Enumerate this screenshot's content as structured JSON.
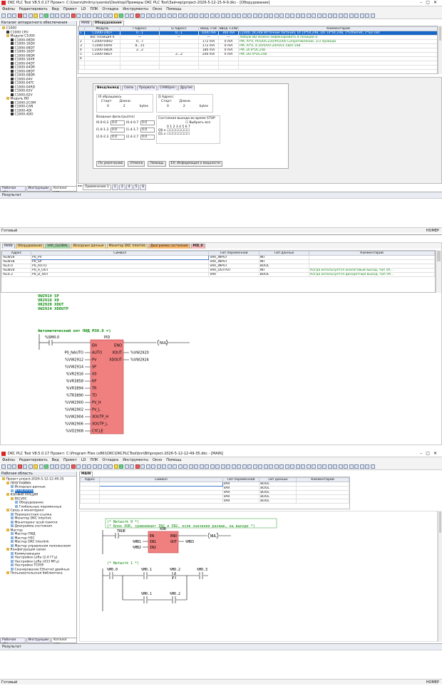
{
  "w1": {
    "title": "DKC PLC Tool V8.5.0.17   Проект: C:\\Users\\dmitriy.lysenko\\Desktop\\Примеры DKC PLC Tool\\Зайчер\\project-2026-5-12-15-9-9.dkc - [Оборудование]",
    "menu": [
      "Файлы",
      "Редактировать",
      "Вид",
      "Проект",
      "LD",
      "ПЛК",
      "Отладка",
      "Инструменты",
      "Окно",
      "Помощь"
    ],
    "tree_header": "Каталог аппаратного обеспечения",
    "tree": [
      "C1000",
      "C1000 CPU",
      "Модули C1000",
      "C1000-08DX",
      "C1000-16DX",
      "C1000-08DT",
      "C1000-16DT",
      "C1000-08DR",
      "C1000-16XR",
      "C1000-04DT",
      "C1000-04DR",
      "C1000-08DT",
      "C1000-08DR",
      "C1000-04V",
      "C1000-04TC",
      "C1000-04RD",
      "C1000-02V",
      "C1000-02V",
      "Модуль BD",
      "C1000-2COM",
      "C1000-CAN",
      "C1000-4DI",
      "C1000-4DO"
    ],
    "doc_tabs": [
      "MAIN",
      "Оборудование"
    ],
    "hw_cols": [
      "",
      "Модуль",
      "I Адресс",
      "Q Адресс",
      "Ввод +5В",
      "Ввод +24В",
      "Комментарий"
    ],
    "hw_rows": [
      [
        "1",
        "C1000-24DT",
        "0...1",
        "0...1",
        "1000 mA",
        "360 mA",
        "C1000, DC24B Источник питания, DI 14*DC24B, DO 10*DC24B, 1*Ethernet, 1*SD slot"
      ],
      [
        "",
        "BD: Позиция 0",
        "—",
        "—",
        "—",
        "—",
        "Любую BD можно зафиксировать в позиции 0."
      ],
      [
        "2",
        "C1000-04RD",
        "0...7",
        "",
        "172 mA",
        "0 mA",
        "PM, AI*4, Pt100/Cu50/Pt1000 Сопротивление, 2/3 провода"
      ],
      [
        "3",
        "C1000-04AV",
        "8...15",
        "",
        "172 mA",
        "0 mA",
        "PM, AI*4, 4-20mA/0-20mA/1-5B/0-10B"
      ],
      [
        "4",
        "C1000-08DX",
        "2...2",
        "",
        "180 mA",
        "0 mA",
        "PM, DI 8*DC24B"
      ],
      [
        "5",
        "C1000-08DT",
        "",
        "2...2",
        "200 mA",
        "0 mA",
        "PM, DO 8*DC24B"
      ],
      [
        "6",
        "",
        "",
        "",
        "",
        "",
        ""
      ]
    ],
    "cfg_tabs": [
      "Ввод/вывод",
      "Связь",
      "Прервать",
      "CANOpen",
      "Другие"
    ],
    "i_group": "I0 обращаюсь",
    "q_group": "Q Адресс",
    "start_label": "Старт:",
    "len_label": "Длина:",
    "i_start": "0",
    "i_len": "2",
    "q_start": "0",
    "q_len": "2",
    "bytes": "bytes",
    "filter_label": "Входные фильтры(ms)",
    "filters": [
      [
        "I0.0-0.3",
        "0.0",
        "I0.4-0.7",
        "0.0"
      ],
      [
        "I1.0-1.3",
        "0.0",
        "I1.4-1.7",
        "0.0"
      ],
      [
        "I2.0-2.3",
        "0.0",
        "I2.4-2.7",
        "0.0"
      ]
    ],
    "stop_label": "Состояния выхода во время STOP",
    "select_all": "Выбрать все",
    "bits": "0 1 2 3 4 5 6 7",
    "q0": "Q0.x",
    "q1": "Q1.x",
    "buttons": [
      "По умолчанию",
      "Отмена",
      "Помощь",
      "ЕХ: Информация о мощности"
    ],
    "bottom_tabs": [
      "Рабочая обл...",
      "Инструкции",
      "Каталог апп..."
    ],
    "page_tabs": [
      "Применение 1",
      "2",
      "3",
      "4",
      "5",
      "6"
    ],
    "result": "Результат",
    "status_left": "Готовый",
    "status_right": "НОМЕР"
  },
  "w2": {
    "tabs": [
      "MAIN",
      "Оборудование",
      "VAR_GLOBAL",
      "Исходные данные",
      "Монитор DKC Interlink",
      "Диаграмма состояния",
      "PID_0"
    ],
    "cols": [
      "Адрес",
      "Символ",
      "Тип переменной",
      "Тип данных",
      "Комментарий"
    ],
    "rows": [
      [
        "%LW16",
        "P0_PV",
        "VAR_INPUT",
        "INT",
        ""
      ],
      [
        "%LW18",
        "P0_SP",
        "VAR_INPUT",
        "INT",
        ""
      ],
      [
        "%L0.0",
        "P0_AUTO",
        "VAR_INPUT",
        "BOOL",
        ""
      ],
      [
        "%LW20",
        "P0_A_OUT",
        "VAR_OUTPUT",
        "INT",
        "Когда используется аналоговый выход, тип VA..."
      ],
      [
        "%L0.2",
        "P0_D_OUT",
        "VAR",
        "BOOL",
        "Когда используется дискретный выход, тип VA..."
      ]
    ],
    "code": [
      "VW2914 SP",
      "VR2916 X0",
      "VR2920 XOUT",
      "VW2924 XDOUTP"
    ],
    "comment": "Автоматический опт ПИД  M30.0 =)",
    "contact": "%SM0.0",
    "block_name": "PID",
    "pins_in": [
      "EN",
      "AUTO",
      "PV",
      "SP",
      "X0",
      "KP",
      "TR",
      "TD",
      "PV_H",
      "PV_L",
      "XOUTP_H",
      "XOUTP_L",
      "CYCLE"
    ],
    "pins_out": [
      "ENO",
      "XOUT",
      "XDOUT"
    ],
    "inputs": [
      "",
      "P0_NAUTO",
      "%VW2912",
      "%VW2914",
      "%VR2916",
      "%VR3858",
      "%VR3894",
      "%TR3890",
      "%VW2900",
      "%VW2902",
      "%VW2904",
      "%VW2906",
      "%VD2908"
    ],
    "outputs": [
      "",
      "%VW2920",
      "%VW2924"
    ],
    "coil": "NUL"
  },
  "w3": {
    "title": "DKC PLC Tool V8.5.0.17   Проект: C:\\Program Files (x86)\\DKC\\DKCPLCTool\\bin\\Bit\\project-2026-5-12-12-49-35.dkc - [MAIN]",
    "menu": [
      "Файлы",
      "Редактировать",
      "Вид",
      "Проект",
      "LD",
      "ПЛК",
      "Отладка",
      "Инструменты",
      "Окно",
      "Помощь"
    ],
    "tree_header": "Рабочая область",
    "tree": [
      "Проект project-2026-5-12-12-49-35",
      "ПРОГРАММА",
      "Исходные данные",
      "MAIN(MAIN)",
      "КОНФИГУРАЦИЯ",
      "РЕСУРС",
      "Оборудование",
      "Глобальные переменные",
      "Связь и мониторинг",
      "Перекрестная ссылка",
      "Монитор DKC Interlink",
      "Мониторинг всей памяти",
      "Диаграмма состояния",
      "Мастер",
      "Мастер ПИД",
      "Мастер HSC",
      "Мастер DKC Interlink",
      "Мастер управления положением",
      "Конфигурация связи",
      "Коммуникация",
      "Настройки LoRa (2,4 ГГц)",
      "Настройки LoRa (433 МГц)",
      "Настройки TCP/IP",
      "Сканирование Ethernet двойных",
      "Пользовательская библиотека"
    ],
    "doc_tab": "MAIN",
    "cols": [
      "Адрес",
      "Символ",
      "Тип переменной",
      "Тип данных",
      "Комментарий"
    ],
    "rows": [
      [
        "",
        "",
        "VAR",
        "BOOL",
        ""
      ],
      [
        "",
        "",
        "VAR",
        "BOOL",
        ""
      ],
      [
        "",
        "",
        "VAR",
        "BOOL",
        ""
      ],
      [
        "",
        "",
        "VAR",
        "BOOL",
        ""
      ],
      [
        "",
        "",
        "VAR",
        "BOOL",
        ""
      ]
    ],
    "net0": "(* Network 0 *)",
    "net0_desc": "(* Блок XOR, сравнивает IN1 и IN2, если значения разные, на выходе *)",
    "true_lbl": "TRUE",
    "xor_name": "XOR",
    "xor_in": [
      "EN",
      "IN1",
      "IN2"
    ],
    "xor_out": [
      "ENO",
      "OUT"
    ],
    "xor_vars": [
      "%MB1",
      "%MB2"
    ],
    "xor_outvar": "%MB3",
    "coil": "NUL",
    "net1": "(* Network 1 *)",
    "contacts": [
      "%M0.0",
      "%M0.1",
      "%M0.2",
      "%M0.3"
    ],
    "branch": [
      "%M0.1",
      "%M0.2"
    ],
    "bottom_tabs": [
      "Рабочая обл...",
      "Инструкции",
      "Каталог апп..."
    ],
    "result": "Результат",
    "status_left": "Готовый",
    "status_right": "НОМЕР"
  }
}
